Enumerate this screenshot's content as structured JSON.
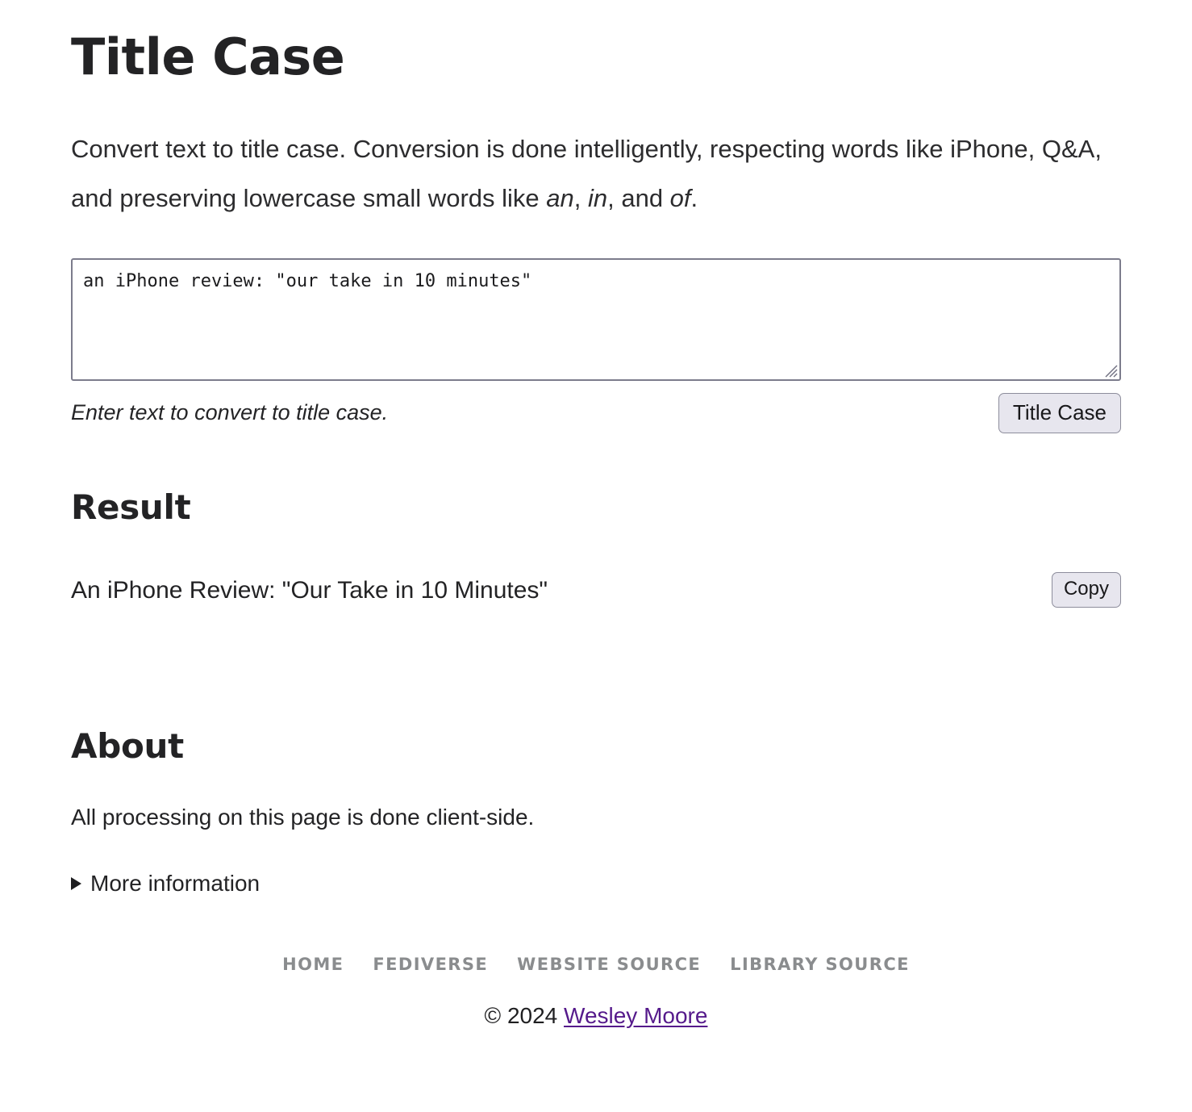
{
  "page": {
    "title": "Title Case",
    "intro": {
      "part1": "Convert text to title case. Conversion is done intelligently, respecting words like iPhone, Q&A, and preserving lowercase small words like ",
      "em1": "an",
      "sep1": ", ",
      "em2": "in",
      "sep2": ", and ",
      "em3": "of",
      "end": "."
    }
  },
  "input": {
    "value": "an iPhone review: \"our take in 10 minutes\"",
    "placeholder": "",
    "helper_text": "Enter text to convert to title case.",
    "submit_label": "Title Case",
    "resize_handle": "resize-grip-icon"
  },
  "result": {
    "heading": "Result",
    "text": "An iPhone Review: \"Our Take in 10 Minutes\"",
    "copy_label": "Copy"
  },
  "about": {
    "heading": "About",
    "text": "All processing on this page is done client-side.",
    "more_info_label": "More information",
    "more_info_open": false
  },
  "footer": {
    "nav": [
      {
        "label": "Home"
      },
      {
        "label": "Fediverse"
      },
      {
        "label": "Website Source"
      },
      {
        "label": "Library Source"
      }
    ],
    "copyright_prefix": "© 2024 ",
    "author": "Wesley Moore"
  },
  "colors": {
    "text": "#232325",
    "button_bg": "#e7e6ee",
    "button_border": "#8d8d9c",
    "textarea_border": "#7c7c8c",
    "footer_nav": "#8a8c8e",
    "link_purple": "#551a8b",
    "background": "#ffffff"
  }
}
